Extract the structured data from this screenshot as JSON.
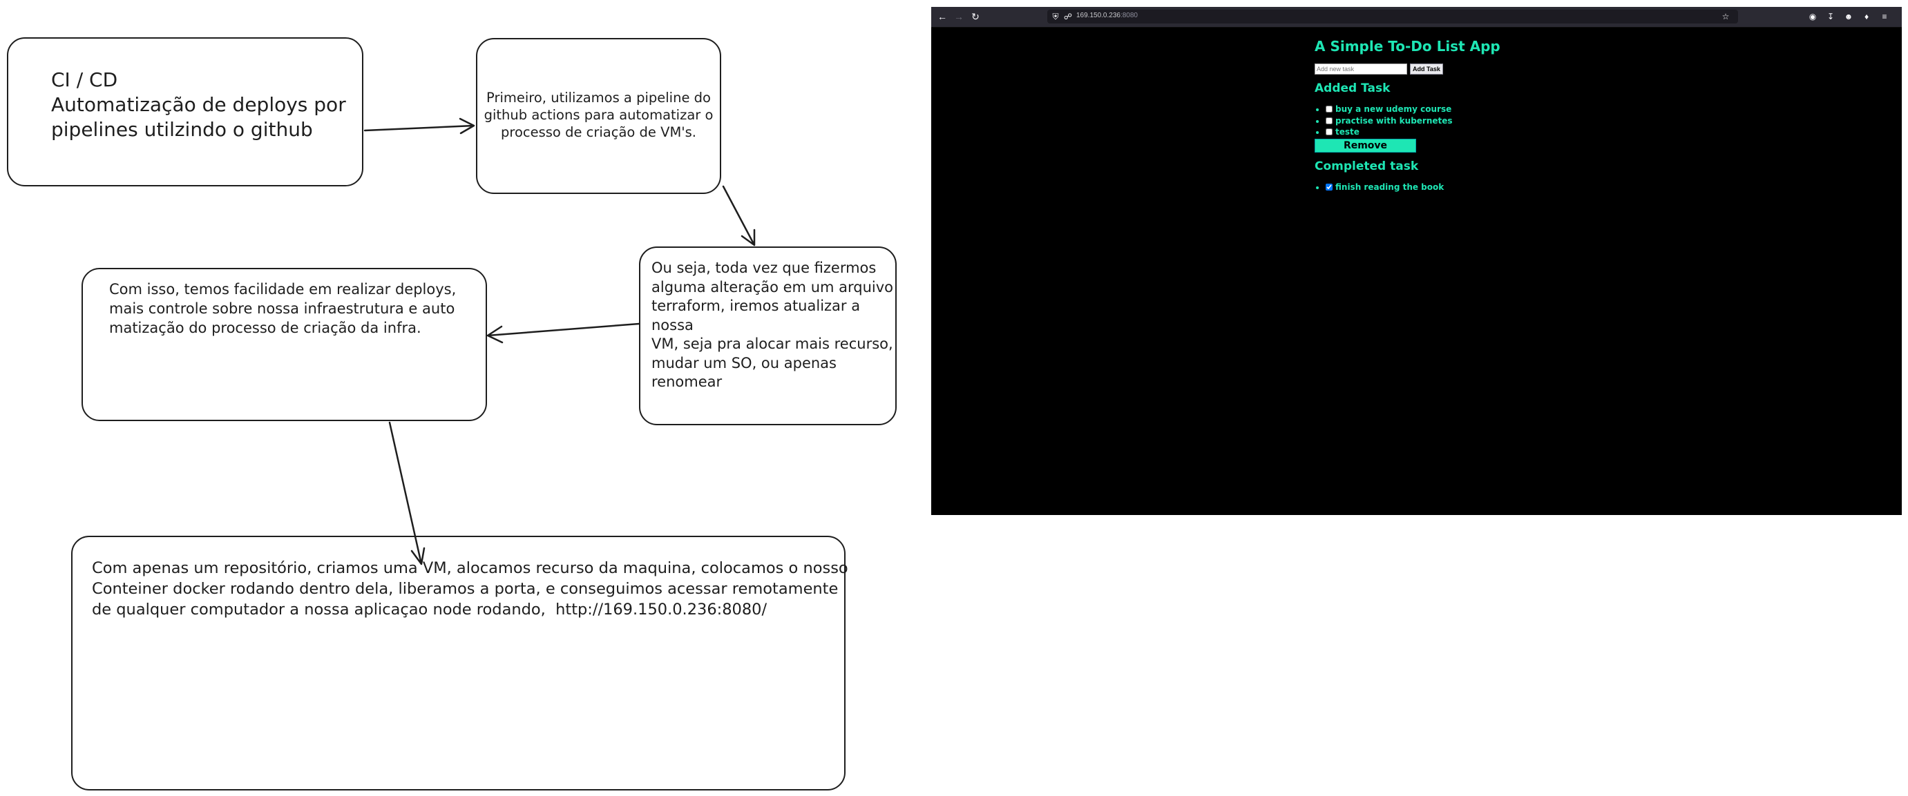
{
  "diagram": {
    "boxes": [
      {
        "id": "box1",
        "text": "CI / CD\nAutomatização de deploys por\npipelines utilzindo o github"
      },
      {
        "id": "box2",
        "text": "Primeiro, utilizamos a pipeline do\ngithub actions para automatizar o\nprocesso de criação de VM's."
      },
      {
        "id": "box3",
        "text": "Ou seja, toda vez que fizermos\nalguma alteração em um arquivo\nterraform, iremos atualizar a\nnossa\nVM, seja pra alocar mais recurso,\nmudar um SO, ou apenas renomear"
      },
      {
        "id": "box4",
        "text": "Com isso, temos facilidade em realizar deploys,\nmais controle sobre nossa infraestrutura e auto\nmatização do processo de criação da infra."
      },
      {
        "id": "box5",
        "text": "Com apenas um repositório, criamos uma VM, alocamos recurso da maquina, colocamos o nosso\nConteiner docker rodando dentro dela, liberamos a porta, e conseguimos acessar remotamente\nde qualquer computador a nossa aplicaçao node rodando,  http://169.150.0.236:8080/"
      }
    ]
  },
  "browser": {
    "url_host": "169.150.0.236",
    "url_port": ":8080",
    "icons": {
      "back": "arrow-left-icon",
      "forward": "arrow-right-icon",
      "reload": "reload-icon",
      "shield": "shield-icon",
      "lock": "lock-icon",
      "star": "star-icon",
      "pocket": "pocket-icon",
      "download": "download-icon",
      "account": "account-icon",
      "extensions": "extensions-icon",
      "menu": "menu-icon"
    }
  },
  "app": {
    "title": "A Simple To-Do List App",
    "input_placeholder": "Add new task",
    "add_button": "Add Task",
    "added_heading": "Added Task",
    "added_tasks": [
      "buy a new udemy course",
      "practise with kubernetes",
      "teste"
    ],
    "remove_button": "Remove",
    "completed_heading": "Completed task",
    "completed_tasks": [
      "finish reading the book"
    ],
    "accent_color": "#1ee6b4",
    "background_color": "#000000"
  }
}
